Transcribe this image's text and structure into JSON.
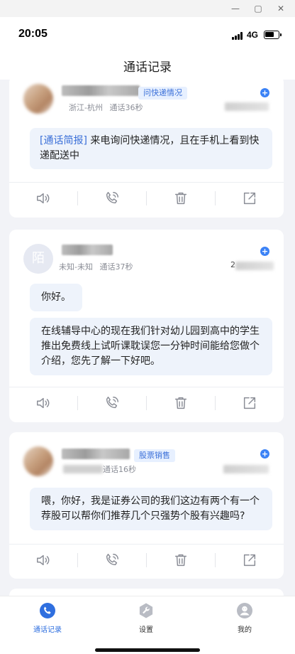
{
  "status": {
    "time": "20:05",
    "network": "4G",
    "battery_level": 0.7
  },
  "header": {
    "title": "通话记录"
  },
  "records": [
    {
      "tag": "问快递情况",
      "location": "浙江-杭州",
      "duration": "通话36秒",
      "date_prefix": "",
      "summary_tag": "[通话简报]",
      "summary_text": " 来电询问快递情况，且在手机上看到快递配送中",
      "messages": []
    },
    {
      "avatar_text": "陌",
      "location": "未知-未知",
      "duration": "通话37秒",
      "date_prefix": "2",
      "messages": [
        "你好。",
        "在线辅导中心的现在我们针对幼儿园到高中的学生推出免费线上试听课耽误您一分钟时间能给您做个介绍，您先了解一下好吧。"
      ]
    },
    {
      "tag": "股票销售",
      "location": "",
      "duration": "通话16秒",
      "date_prefix": "",
      "messages": [
        "喂，你好，我是证券公司的我们这边有两个有一个荐股可以帮你们推荐几个只强势个股有兴趣吗?"
      ]
    }
  ],
  "actions": [
    "play-recording",
    "call-back",
    "delete",
    "share"
  ],
  "bottom_nav": [
    {
      "label": "通话记录",
      "icon": "call-records-icon",
      "active": true
    },
    {
      "label": "设置",
      "icon": "settings-wrench-icon",
      "active": false
    },
    {
      "label": "我的",
      "icon": "profile-icon",
      "active": false
    }
  ],
  "colors": {
    "accent": "#2f6fdf",
    "tag_bg": "#e7f0ff",
    "bubble_bg": "#eef3fb",
    "page_bg": "#f2f3f7"
  }
}
